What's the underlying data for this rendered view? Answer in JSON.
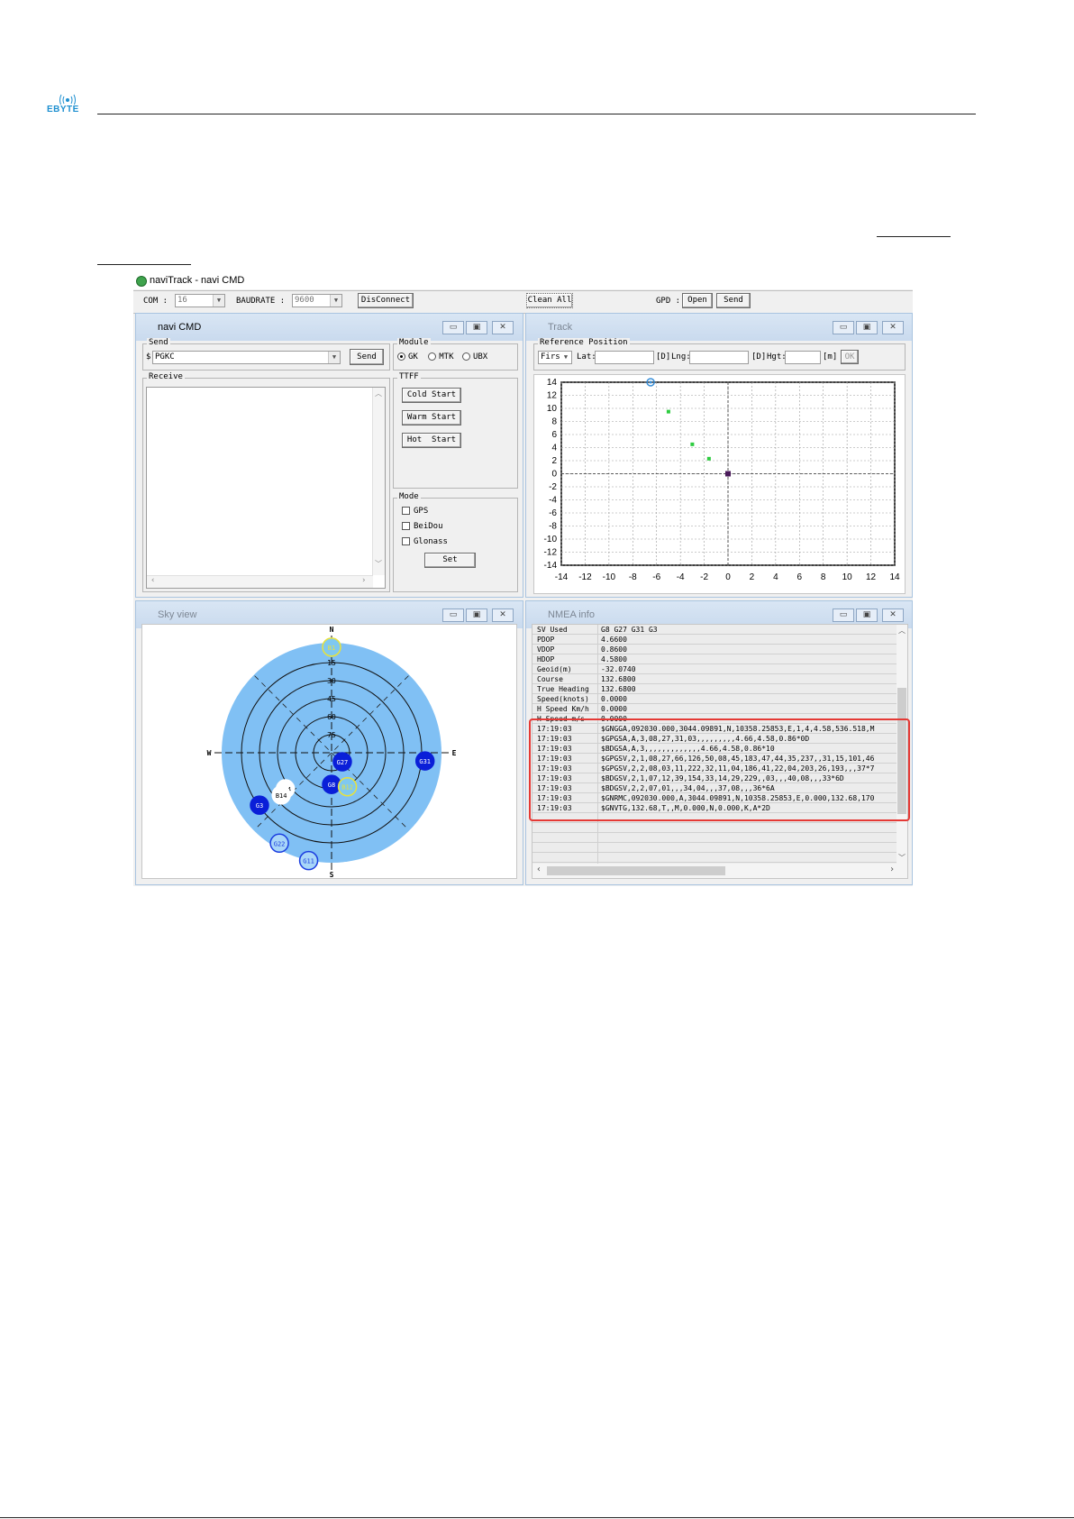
{
  "page": {
    "logo_text": "EBYTE"
  },
  "app": {
    "title": "naviTrack - navi CMD",
    "toolbar": {
      "com_label": "COM :",
      "com_value": "16",
      "baud_label": "BAUDRATE :",
      "baud_value": "9600",
      "disconnect_label": "DisConnect",
      "clean_all_label": "Clean All",
      "gpd_label": "GPD :",
      "open_label": "Open",
      "send_label": "Send"
    }
  },
  "navi_cmd": {
    "title": "navi CMD",
    "send_group": "Send",
    "prefix": "$",
    "command_value": "PGKC",
    "send_button": "Send",
    "receive_group": "Receive",
    "module_group": "Module",
    "modules": [
      {
        "label": "GK",
        "selected": true
      },
      {
        "label": "MTK",
        "selected": false
      },
      {
        "label": "UBX",
        "selected": false
      }
    ],
    "ttff_group": "TTFF",
    "cold_start": "Cold Start",
    "warm_start": "Warm Start",
    "hot_start": "Hot  Start",
    "mode_group": "Mode",
    "mode_options": [
      {
        "label": "GPS",
        "checked": false
      },
      {
        "label": "BeiDou",
        "checked": false
      },
      {
        "label": "Glonass",
        "checked": false
      }
    ],
    "set_button": "Set"
  },
  "track": {
    "title": "Track",
    "ref_group": "Reference Position",
    "ref_select": "Firs",
    "lat_label": "Lat:",
    "lat_unit": "[D]",
    "lng_label": "Lng:",
    "lng_unit": "[D]",
    "hgt_label": "Hgt:",
    "hgt_unit": "[m]",
    "ok_label": "OK"
  },
  "chart_data": {
    "type": "scatter",
    "xlim": [
      -14,
      14
    ],
    "ylim": [
      -14,
      14
    ],
    "x_ticks": [
      -14,
      -12,
      -10,
      -8,
      -6,
      -4,
      -2,
      0,
      2,
      4,
      6,
      8,
      10,
      12,
      14
    ],
    "y_ticks": [
      14,
      12,
      10,
      8,
      6,
      4,
      2,
      0,
      -2,
      -4,
      -6,
      -8,
      -10,
      -12,
      -14
    ],
    "grid": true,
    "points": [
      {
        "x": -6.5,
        "y": 14,
        "kind": "current",
        "color": "#3a8fd8"
      },
      {
        "x": -5.0,
        "y": 9.5,
        "kind": "fix",
        "color": "#2ecc40"
      },
      {
        "x": -3.0,
        "y": 4.5,
        "kind": "fix",
        "color": "#2ecc40"
      },
      {
        "x": -1.6,
        "y": 2.3,
        "kind": "fix",
        "color": "#2ecc40"
      },
      {
        "x": 0,
        "y": 0,
        "kind": "reference",
        "color": "#4a1a5a"
      }
    ]
  },
  "sky_view": {
    "title": "Sky view",
    "compass": {
      "n": "N",
      "s": "S",
      "e": "E",
      "w": "W"
    },
    "elevation_labels": [
      "15",
      "30",
      "45",
      "60",
      "75"
    ],
    "satellites": [
      {
        "id": "B1",
        "az": 0,
        "el": 0,
        "style": "yellow"
      },
      {
        "id": "G27",
        "az": 130,
        "el": 78,
        "style": "blue"
      },
      {
        "id": "G31",
        "az": 95,
        "el": 10,
        "style": "blue"
      },
      {
        "id": "G8",
        "az": 180,
        "el": 63,
        "style": "blue"
      },
      {
        "id": "B12",
        "az": 155,
        "el": 58,
        "style": "yellow"
      },
      {
        "id": "B44",
        "az": 232,
        "el": 40,
        "style": "white"
      },
      {
        "id": "B14",
        "az": 230,
        "el": 34,
        "style": "white"
      },
      {
        "id": "G3",
        "az": 234,
        "el": 14,
        "style": "blue"
      },
      {
        "id": "G22",
        "az": 210,
        "el": 1,
        "style": "outline"
      },
      {
        "id": "G11",
        "az": 192,
        "el": -4,
        "style": "outline"
      }
    ]
  },
  "nmea_info": {
    "title": "NMEA info",
    "summary": [
      {
        "k": "SV Used",
        "v": "G8 G27 G31 G3"
      },
      {
        "k": "PDOP",
        "v": "4.6600"
      },
      {
        "k": "VDOP",
        "v": "0.8600"
      },
      {
        "k": "HDOP",
        "v": "4.5800"
      },
      {
        "k": "Geoid(m)",
        "v": "-32.0740"
      },
      {
        "k": "Course",
        "v": "132.6800"
      },
      {
        "k": "True Heading",
        "v": "132.6800"
      },
      {
        "k": "Speed(knots)",
        "v": "0.0000"
      },
      {
        "k": "H Speed Km/h",
        "v": "0.0000"
      },
      {
        "k": "H Speed m/s",
        "v": "0.0000"
      }
    ],
    "sentences": [
      {
        "t": "17:19:03",
        "s": "$GNGGA,092030.000,3044.09891,N,10358.25853,E,1,4,4.58,536.518,M"
      },
      {
        "t": "17:19:03",
        "s": "$GPGSA,A,3,08,27,31,03,,,,,,,,,4.66,4.58,0.86*0D"
      },
      {
        "t": "17:19:03",
        "s": "$BDGSA,A,3,,,,,,,,,,,,,4.66,4.58,0.86*10"
      },
      {
        "t": "17:19:03",
        "s": "$GPGSV,2,1,08,27,66,126,50,08,45,183,47,44,35,237,,31,15,101,46"
      },
      {
        "t": "17:19:03",
        "s": "$GPGSV,2,2,08,03,11,222,32,11,04,186,41,22,04,203,26,193,,,37*7"
      },
      {
        "t": "17:19:03",
        "s": "$BDGSV,2,1,07,12,39,154,33,14,29,229,,03,,,40,08,,,33*6D"
      },
      {
        "t": "17:19:03",
        "s": "$BDGSV,2,2,07,01,,,34,04,,,37,08,,,36*6A"
      },
      {
        "t": "17:19:03",
        "s": "$GNRMC,092030.000,A,3044.09891,N,10358.25853,E,0.000,132.68,170"
      },
      {
        "t": "17:19:03",
        "s": "$GNVTG,132.68,T,,M,0.000,N,0.000,K,A*2D"
      }
    ],
    "highlight_color": "#e53935"
  }
}
